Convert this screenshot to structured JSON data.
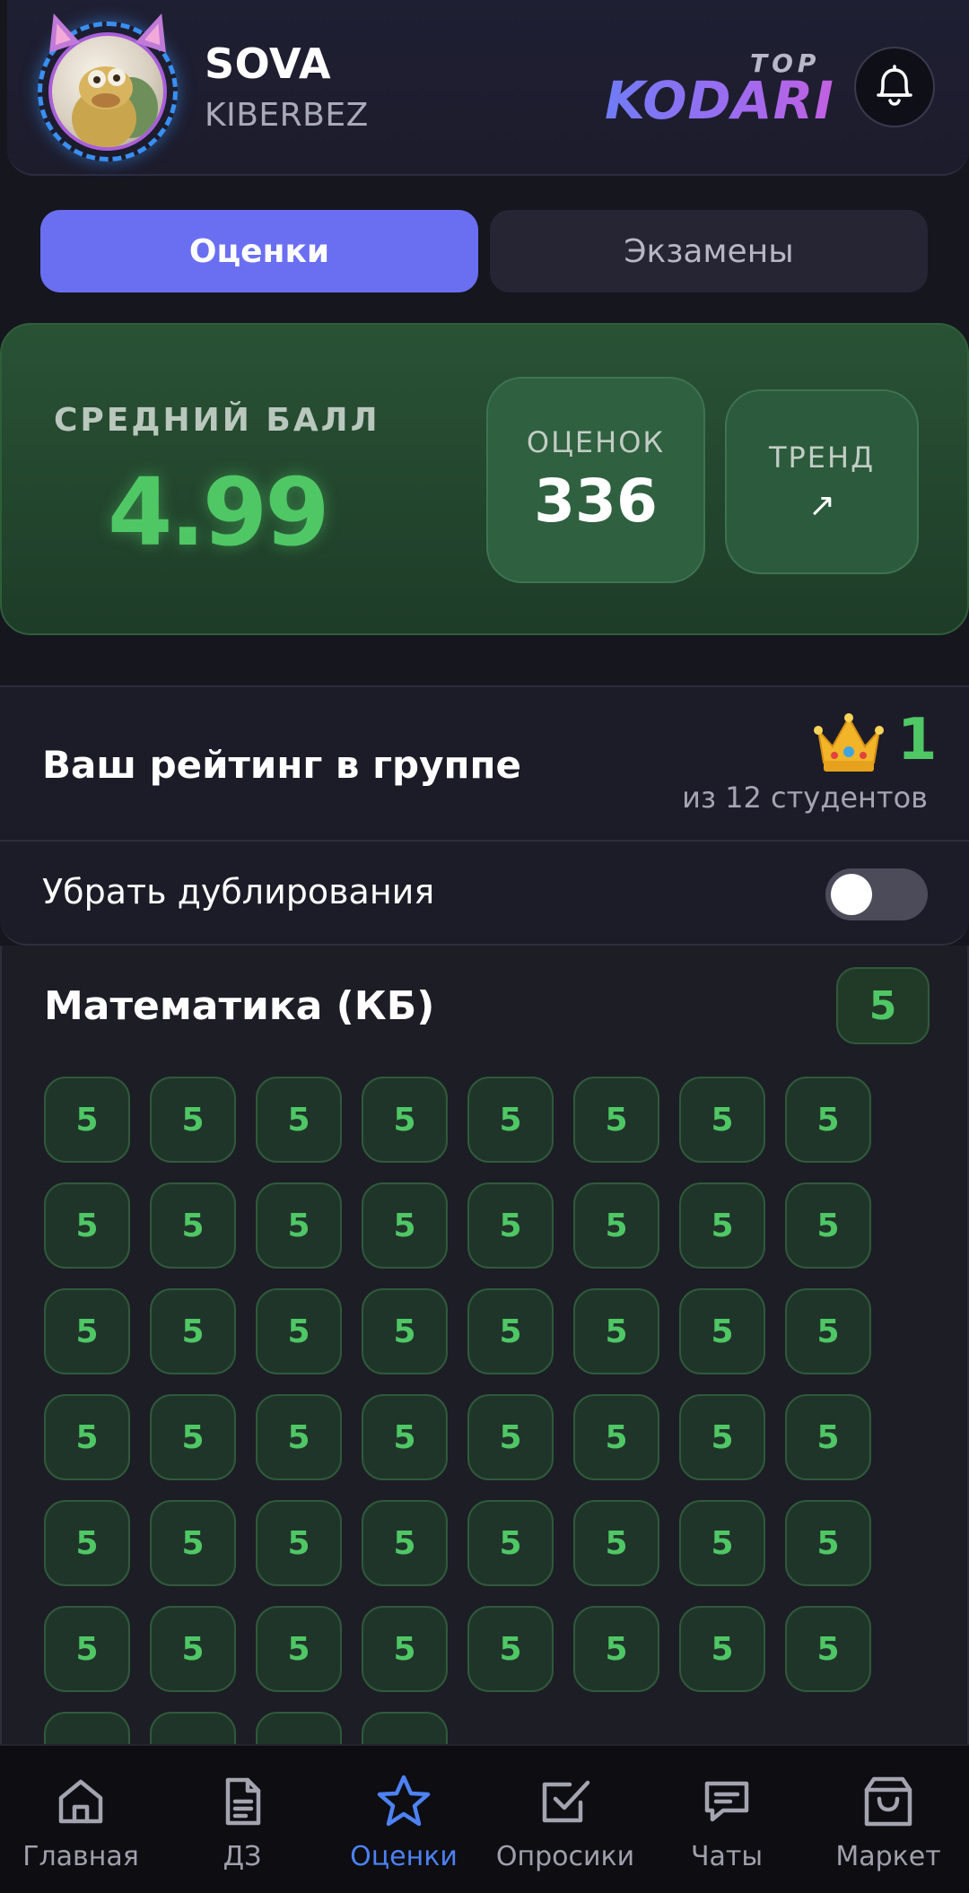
{
  "header": {
    "user_name": "SOVA",
    "user_group": "KIBERBEZ",
    "brand_top": "TOP",
    "brand_main": "KODARI"
  },
  "tabs": [
    {
      "label": "Оценки",
      "active": true
    },
    {
      "label": "Экзамены",
      "active": false
    }
  ],
  "summary": {
    "avg_label": "СРЕДНИЙ БАЛЛ",
    "avg_value": "4.99",
    "count_label": "ОЦЕНОК",
    "count_value": "336",
    "trend_label": "ТРЕНД",
    "trend_icon": "↗"
  },
  "rating": {
    "title": "Ваш рейтинг в группе",
    "place": "1",
    "subtitle": "из 12 студентов",
    "icon": "crown-icon"
  },
  "duplicates_toggle": {
    "label": "Убрать дублирования",
    "enabled": false
  },
  "subject": {
    "title": "Математика (КБ)",
    "average": "5",
    "grades": [
      "5",
      "5",
      "5",
      "5",
      "5",
      "5",
      "5",
      "5",
      "5",
      "5",
      "5",
      "5",
      "5",
      "5",
      "5",
      "5",
      "5",
      "5",
      "5",
      "5",
      "5",
      "5",
      "5",
      "5",
      "5",
      "5",
      "5",
      "5",
      "5",
      "5",
      "5",
      "5",
      "5",
      "5",
      "5",
      "5",
      "5",
      "5",
      "5",
      "5",
      "5",
      "5",
      "5",
      "5",
      "5",
      "5",
      "5",
      "5",
      "",
      "",
      "",
      ""
    ]
  },
  "bottom_nav": [
    {
      "label": "Главная",
      "icon": "home-icon",
      "active": false
    },
    {
      "label": "ДЗ",
      "icon": "document-icon",
      "active": false
    },
    {
      "label": "Оценки",
      "icon": "star-icon",
      "active": true
    },
    {
      "label": "Опросики",
      "icon": "checkbox-icon",
      "active": false
    },
    {
      "label": "Чаты",
      "icon": "chat-icon",
      "active": false
    },
    {
      "label": "Маркет",
      "icon": "shopping-bag-icon",
      "active": false
    }
  ],
  "colors": {
    "accent": "#6a6ff2",
    "grade_green": "#4fc765",
    "nav_active": "#4d82f3"
  }
}
